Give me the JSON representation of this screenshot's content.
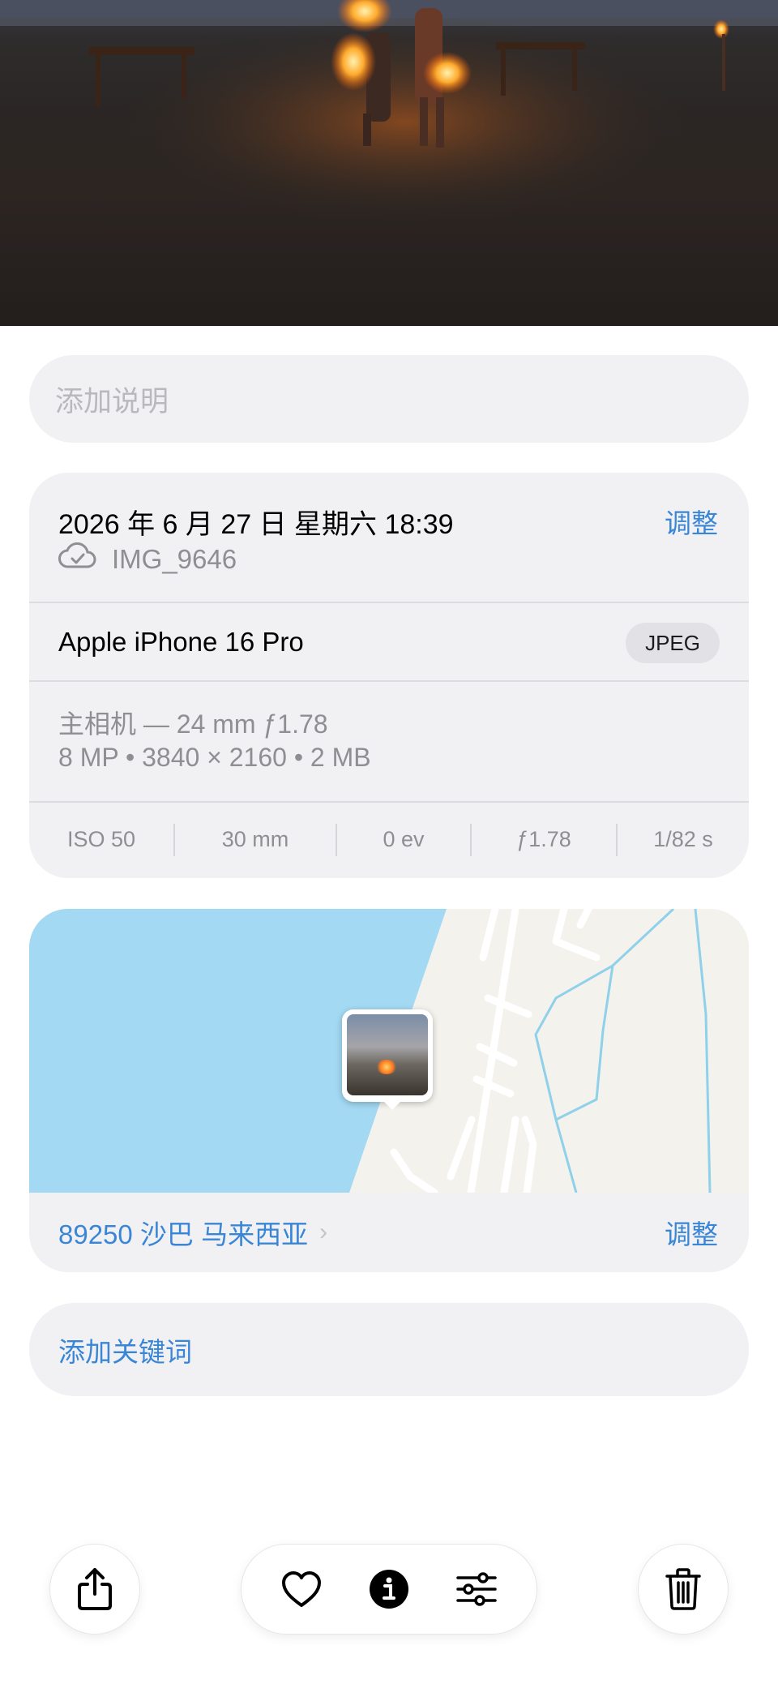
{
  "caption": {
    "placeholder": "添加说明"
  },
  "info": {
    "date": "2026 年 6 月 27 日 星期六 18:39",
    "adjust_label": "调整",
    "filename": "IMG_9646",
    "cloud_icon": "cloud-check-icon",
    "device": "Apple iPhone 16 Pro",
    "format": "JPEG",
    "lens": "主相机 — 24 mm ƒ1.78",
    "resolution": "8 MP • 3840 × 2160 • 2 MB",
    "exif": [
      "ISO 50",
      "30 mm",
      "0 ev",
      "ƒ1.78",
      "1/82 s"
    ]
  },
  "location": {
    "label": "89250 沙巴 马来西亚",
    "adjust_label": "调整"
  },
  "keywords": {
    "label": "添加关键词"
  },
  "toolbar": {
    "share_icon": "share-icon",
    "favorite_icon": "heart-icon",
    "info_icon": "info-icon",
    "edit_icon": "sliders-icon",
    "delete_icon": "trash-icon"
  },
  "colors": {
    "accent": "#3a86d6",
    "card_bg": "#f1f1f4",
    "secondary_text": "#8e8e93",
    "water": "#a3d9f2"
  }
}
